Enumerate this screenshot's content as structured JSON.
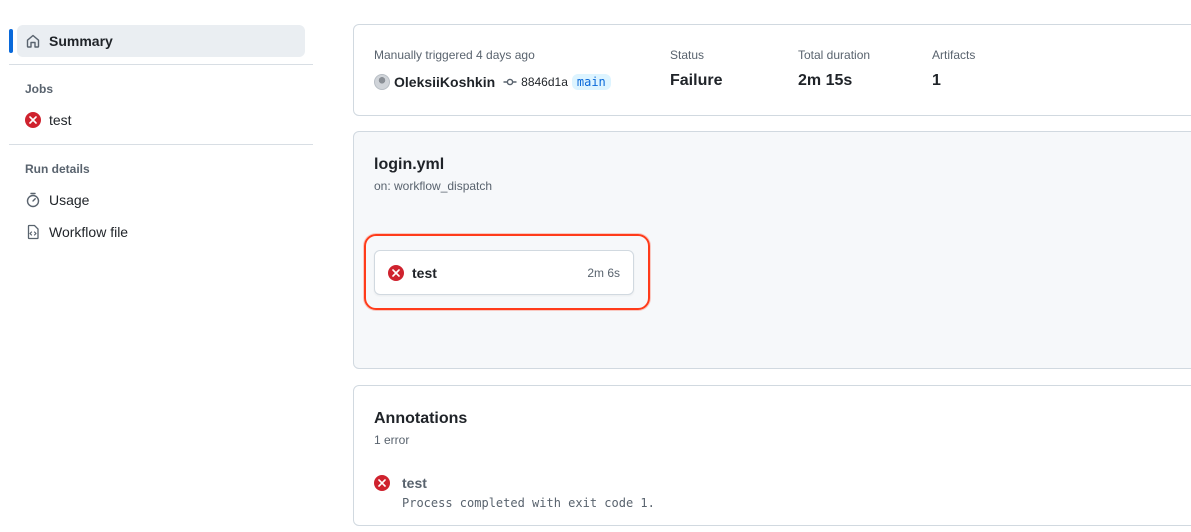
{
  "sidebar": {
    "summary_label": "Summary",
    "jobs_heading": "Jobs",
    "jobs": [
      {
        "label": "test",
        "status": "failure"
      }
    ],
    "run_details_heading": "Run details",
    "run_details": [
      {
        "label": "Usage",
        "icon": "stopwatch-icon"
      },
      {
        "label": "Workflow file",
        "icon": "file-code-icon"
      }
    ]
  },
  "run_info": {
    "trigger_text": "Manually triggered 4 days ago",
    "actor": "OleksiiKoshkin",
    "commit_sha": "8846d1a",
    "branch": "main",
    "status_label": "Status",
    "status_value": "Failure",
    "duration_label": "Total duration",
    "duration_value": "2m 15s",
    "artifacts_label": "Artifacts",
    "artifacts_value": "1"
  },
  "workflow": {
    "file": "login.yml",
    "trigger": "on: workflow_dispatch",
    "job": {
      "name": "test",
      "duration": "2m 6s",
      "status": "failure"
    }
  },
  "annotations": {
    "title": "Annotations",
    "count": "1 error",
    "items": [
      {
        "title": "test",
        "message": "Process completed with exit code 1."
      }
    ]
  },
  "colors": {
    "failure": "#cf222e",
    "accent": "#0969da",
    "highlight": "#ff3b1a"
  }
}
